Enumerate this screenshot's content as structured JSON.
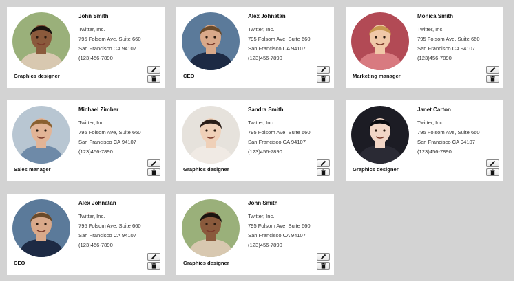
{
  "contacts": [
    {
      "name": "John Smith",
      "company": "Twitter, Inc.",
      "address": "795 Folsom Ave, Suite 660",
      "city": "San Francisco CA 94107",
      "phone": "(123)456-7890",
      "role": "Graphics designer",
      "avatar": {
        "bg": "#9ab07a",
        "skin": "#8a5a3c",
        "hair": "#1a1410",
        "shirt": "#d8c8b0"
      }
    },
    {
      "name": "Alex Johnatan",
      "company": "Twitter, Inc.",
      "address": "795 Folsom Ave, Suite 660",
      "city": "San Francisco CA 94107",
      "phone": "(123)456-7890",
      "role": "CEO",
      "avatar": {
        "bg": "#5b7a9a",
        "skin": "#d9a98a",
        "hair": "#6a4a2a",
        "shirt": "#1d2a44"
      }
    },
    {
      "name": "Monica Smith",
      "company": "Twitter, Inc.",
      "address": "795 Folsom Ave, Suite 660",
      "city": "San Francisco CA 94107",
      "phone": "(123)456-7890",
      "role": "Marketing manager",
      "avatar": {
        "bg": "#b24a55",
        "skin": "#f0c8a8",
        "hair": "#c89850",
        "shirt": "#d87a80"
      }
    },
    {
      "name": "Michael Zimber",
      "company": "Twitter, Inc.",
      "address": "795 Folsom Ave, Suite 660",
      "city": "San Francisco CA 94107",
      "phone": "(123)456-7890",
      "role": "Sales manager",
      "avatar": {
        "bg": "#b8c6d2",
        "skin": "#e2b496",
        "hair": "#8a6030",
        "shirt": "#6e8aa8"
      }
    },
    {
      "name": "Sandra Smith",
      "company": "Twitter, Inc.",
      "address": "795 Folsom Ave, Suite 660",
      "city": "San Francisco CA 94107",
      "phone": "(123)456-7890",
      "role": "Graphics designer",
      "avatar": {
        "bg": "#e6e2dc",
        "skin": "#efd0b8",
        "hair": "#2a1e18",
        "shirt": "#f0eae4"
      }
    },
    {
      "name": "Janet Carton",
      "company": "Twitter, Inc.",
      "address": "795 Folsom Ave, Suite 660",
      "city": "San Francisco CA 94107",
      "phone": "(123)456-7890",
      "role": "Graphics designer",
      "avatar": {
        "bg": "#1c1c24",
        "skin": "#f2d6c6",
        "hair": "#0c0c10",
        "shirt": "#2a2a34"
      }
    },
    {
      "name": "Alex Johnatan",
      "company": "Twitter, Inc.",
      "address": "795 Folsom Ave, Suite 660",
      "city": "San Francisco CA 94107",
      "phone": "(123)456-7890",
      "role": "CEO",
      "avatar": {
        "bg": "#5b7a9a",
        "skin": "#d9a98a",
        "hair": "#6a4a2a",
        "shirt": "#1d2a44"
      }
    },
    {
      "name": "John Smith",
      "company": "Twitter, Inc.",
      "address": "795 Folsom Ave, Suite 660",
      "city": "San Francisco CA 94107",
      "phone": "(123)456-7890",
      "role": "Graphics designer",
      "avatar": {
        "bg": "#9ab07a",
        "skin": "#8a5a3c",
        "hair": "#1a1410",
        "shirt": "#d8c8b0"
      }
    }
  ],
  "actions": {
    "edit_icon": "pencil-icon",
    "delete_icon": "trash-icon"
  }
}
